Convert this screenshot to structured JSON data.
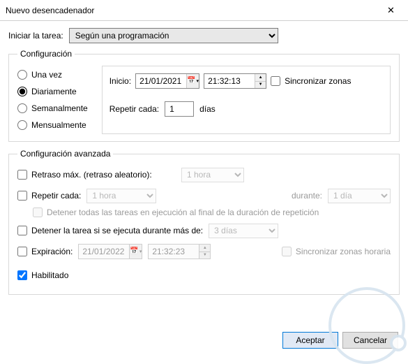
{
  "title": "Nuevo desencadenador",
  "begin_label": "Iniciar la tarea:",
  "begin_value": "Según una programación",
  "config": {
    "legend": "Configuración",
    "radios": {
      "once": "Una vez",
      "daily": "Diariamente",
      "weekly": "Semanalmente",
      "monthly": "Mensualmente"
    },
    "start_label": "Inicio:",
    "start_date": "21/01/2021",
    "start_time": "21:32:13",
    "sync_label": "Sincronizar zonas",
    "recur_label": "Repetir cada:",
    "recur_value": "1",
    "recur_unit": "días"
  },
  "advanced": {
    "legend": "Configuración avanzada",
    "delay_label": "Retraso máx. (retraso aleatorio):",
    "delay_value": "1 hora",
    "repeat_label": "Repetir cada:",
    "repeat_value": "1 hora",
    "duration_label": "durante:",
    "duration_value": "1 día",
    "stop_end_label": "Detener todas las tareas en ejecución al final de la duración de repetición",
    "stop_after_label": "Detener la tarea si se ejecuta durante más de:",
    "stop_after_value": "3 días",
    "expire_label": "Expiración:",
    "expire_date": "21/01/2022",
    "expire_time": "21:32:23",
    "sync_tz_label": "Sincronizar zonas horaria",
    "enabled_label": "Habilitado"
  },
  "buttons": {
    "ok": "Aceptar",
    "cancel": "Cancelar"
  }
}
